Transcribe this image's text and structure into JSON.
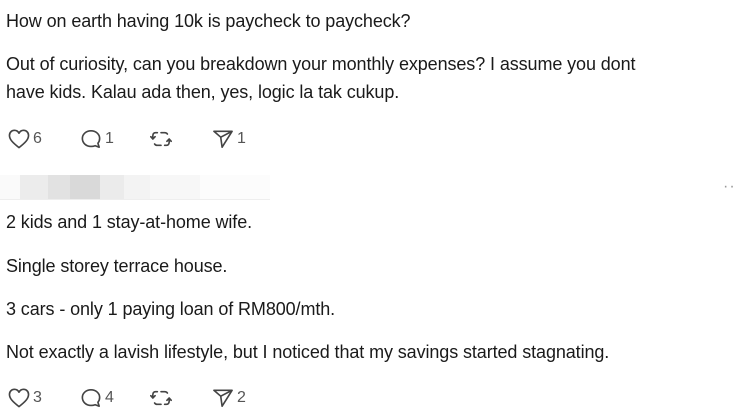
{
  "post1": {
    "line1": "How on earth having 10k is paycheck to paycheck?",
    "line2": "Out of curiosity, can you breakdown your monthly expenses? I assume you dont",
    "line3": "have kids. Kalau ada then, yes, logic la tak cukup.",
    "likes": "6",
    "replies": "1",
    "shares": "1"
  },
  "post2": {
    "more": "··",
    "line1": "2 kids and 1 stay-at-home wife.",
    "line2": "Single storey terrace house.",
    "line3": "3 cars - only 1 paying loan of RM800/mth.",
    "line4": "Not exactly a lavish lifestyle, but I noticed that my savings started stagnating.",
    "likes": "3",
    "replies": "4",
    "shares": "2"
  },
  "icons": [
    "heart-icon",
    "comment-icon",
    "repost-icon",
    "send-icon"
  ],
  "colors": {
    "text": "#1a1a1a",
    "icon": "#444444",
    "count": "#555555"
  }
}
